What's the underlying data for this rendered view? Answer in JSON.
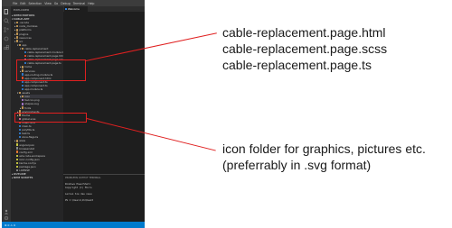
{
  "window": {
    "menu": [
      "File",
      "Edit",
      "Selection",
      "View",
      "Go",
      "Debug",
      "Terminal",
      "Help"
    ]
  },
  "sidebar": {
    "header": "EXPLORER",
    "rows": [
      {
        "text": "OPEN EDITORS",
        "indent": 0,
        "chev": "▸",
        "kind": "section"
      },
      {
        "text": "CABLE-APP",
        "indent": 0,
        "chev": "▾",
        "kind": "section"
      },
      {
        "text": ".vscode",
        "indent": 1,
        "chev": "▸",
        "kind": "folder"
      },
      {
        "text": "node_modules",
        "indent": 1,
        "chev": "▸",
        "kind": "folder"
      },
      {
        "text": "platforms",
        "indent": 1,
        "chev": "▸",
        "kind": "folder"
      },
      {
        "text": "plugins",
        "indent": 1,
        "chev": "▸",
        "kind": "folder"
      },
      {
        "text": "resources",
        "indent": 1,
        "chev": "▸",
        "kind": "folder"
      },
      {
        "text": "src",
        "indent": 1,
        "chev": "▾",
        "kind": "folder"
      },
      {
        "text": "app",
        "indent": 2,
        "chev": "▾",
        "kind": "folder"
      },
      {
        "text": "cable-replacement",
        "indent": 3,
        "chev": "▾",
        "kind": "folder"
      },
      {
        "text": "cable-replacement.module.ts",
        "indent": 4,
        "chev": "",
        "kind": "ts"
      },
      {
        "text": "cable-replacement.page.html",
        "indent": 4,
        "chev": "",
        "kind": "html"
      },
      {
        "text": "cable-replacement.page.scss",
        "indent": 4,
        "chev": "",
        "kind": "scss"
      },
      {
        "text": "cable-replacement.page.ts",
        "indent": 4,
        "chev": "",
        "kind": "ts"
      },
      {
        "text": "home",
        "indent": 3,
        "chev": "▸",
        "kind": "folder"
      },
      {
        "text": "services",
        "indent": 3,
        "chev": "▸",
        "kind": "folder"
      },
      {
        "text": "app-routing.module.ts",
        "indent": 3,
        "chev": "",
        "kind": "ts"
      },
      {
        "text": "app.component.html",
        "indent": 3,
        "chev": "",
        "kind": "html"
      },
      {
        "text": "app.component.ts",
        "indent": 3,
        "chev": "",
        "kind": "ts"
      },
      {
        "text": "app.component.ts",
        "indent": 3,
        "chev": "",
        "kind": "ts"
      },
      {
        "text": "app.module.ts",
        "indent": 3,
        "chev": "",
        "kind": "ts"
      },
      {
        "text": "assets",
        "indent": 2,
        "chev": "▾",
        "kind": "folder"
      },
      {
        "text": "icon",
        "indent": 3,
        "chev": "▸",
        "kind": "folder"
      },
      {
        "text": "favicon.png",
        "indent": 3,
        "chev": "",
        "kind": "img"
      },
      {
        "text": "shapes.svg",
        "indent": 3,
        "chev": "",
        "kind": "img"
      },
      {
        "text": "fonts",
        "indent": 3,
        "chev": "▸",
        "kind": "folder"
      },
      {
        "text": "environments",
        "indent": 2,
        "chev": "▸",
        "kind": "folder"
      },
      {
        "text": "theme",
        "indent": 2,
        "chev": "▸",
        "kind": "folder"
      },
      {
        "text": "global.scss",
        "indent": 2,
        "chev": "",
        "kind": "scss"
      },
      {
        "text": "index.html",
        "indent": 2,
        "chev": "",
        "kind": "html"
      },
      {
        "text": "main.ts",
        "indent": 2,
        "chev": "",
        "kind": "ts"
      },
      {
        "text": "polyfills.ts",
        "indent": 2,
        "chev": "",
        "kind": "ts"
      },
      {
        "text": "test.ts",
        "indent": 2,
        "chev": "",
        "kind": "ts"
      },
      {
        "text": "zone-flags.ts",
        "indent": 2,
        "chev": "",
        "kind": "ts"
      },
      {
        "text": "www",
        "indent": 1,
        "chev": "▸",
        "kind": "folder"
      },
      {
        "text": "angular.json",
        "indent": 1,
        "chev": "",
        "kind": "json"
      },
      {
        "text": "browserslist",
        "indent": 1,
        "chev": "",
        "kind": "file"
      },
      {
        "text": "config.xml",
        "indent": 1,
        "chev": "",
        "kind": "xml"
      },
      {
        "text": "e2e.code-workspace",
        "indent": 1,
        "chev": "",
        "kind": "json"
      },
      {
        "text": "ionic.config.json",
        "indent": 1,
        "chev": "",
        "kind": "json"
      },
      {
        "text": "karma.conf.js",
        "indent": 1,
        "chev": "",
        "kind": "js"
      },
      {
        "text": "package.json",
        "indent": 1,
        "chev": "",
        "kind": "json"
      },
      {
        "text": "LICENSE",
        "indent": 1,
        "chev": "",
        "kind": "file"
      },
      {
        "text": "OUTLINE",
        "indent": 0,
        "chev": "▸",
        "kind": "section"
      },
      {
        "text": "NPM SCRIPTS",
        "indent": 0,
        "chev": "▸",
        "kind": "section"
      }
    ]
  },
  "editor": {
    "tab_label": "Welcome"
  },
  "panel": {
    "tabs": "PROBLEMS   OUTPUT   TERMINAL",
    "lines": [
      "Windows PowerShell",
      "Copyright (C) Micro",
      "",
      "Lernen Sie das neue",
      "",
      "PS C:\\Users\\Ch\\Deskt"
    ]
  },
  "statusbar": {
    "text": "⊗ 0 ⚠ 0"
  },
  "annotations": {
    "files_label_lines": [
      "cable-replacement.page.html",
      "cable-replacement.page.scss",
      "cable-replacement.page.ts"
    ],
    "icon_label_lines": [
      "icon folder for graphics, pictures etc.",
      "(preferrably in .svg format)"
    ]
  },
  "colors": {
    "highlight": "#e02020",
    "ts": "#3178c6",
    "html": "#e44d26",
    "scss": "#cd6799",
    "folder": "#c09553",
    "json": "#cbcb41",
    "img": "#a074c4",
    "js": "#cbcb41",
    "xml": "#e37933",
    "file": "#8a8a8a"
  }
}
